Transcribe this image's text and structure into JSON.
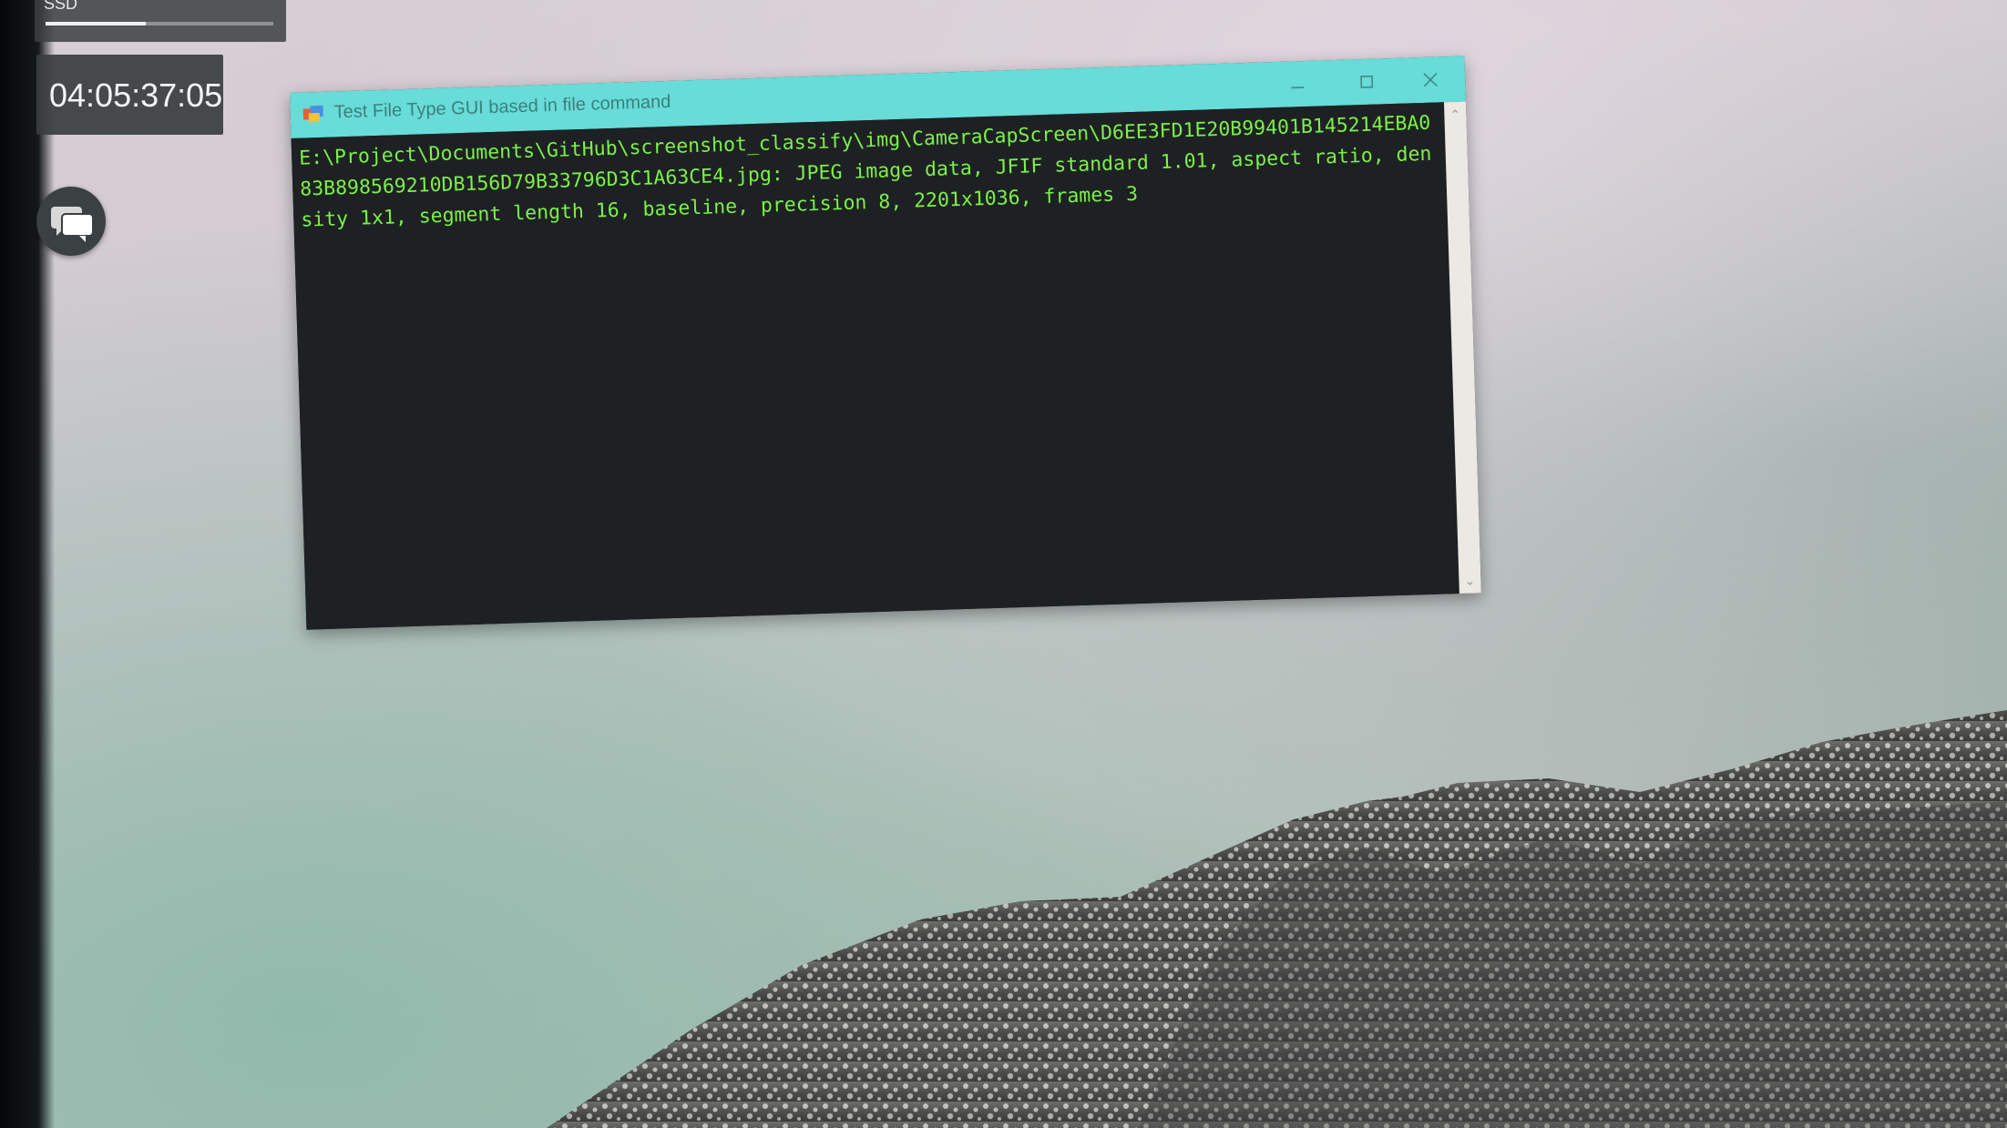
{
  "desktop": {
    "ssd_widget": {
      "label": "SSD",
      "usage_fraction": 0.44
    },
    "clock": {
      "time": "04:05:37:05"
    },
    "chat_button": {
      "icon": "chat-bubbles-icon"
    }
  },
  "window": {
    "title": "Test File Type GUI based in file command",
    "titlebar_color": "#67dcd8",
    "controls": {
      "minimize_icon": "minimize-icon",
      "maximize_icon": "maximize-icon",
      "close_icon": "close-icon"
    },
    "output_text": "E:\\Project\\Documents\\GitHub\\screenshot_classify\\img\\CameraCapScreen\\D6EE3FD1E20B99401B145214EBA083B898569210DB156D79B33796D3C1A63CE4.jpg: JPEG image data, JFIF standard 1.01, aspect ratio, density 1x1, segment length 16, baseline, precision 8, 2201x1036, frames 3",
    "output_color": "#7cf04a",
    "background_color": "#1e2123"
  }
}
